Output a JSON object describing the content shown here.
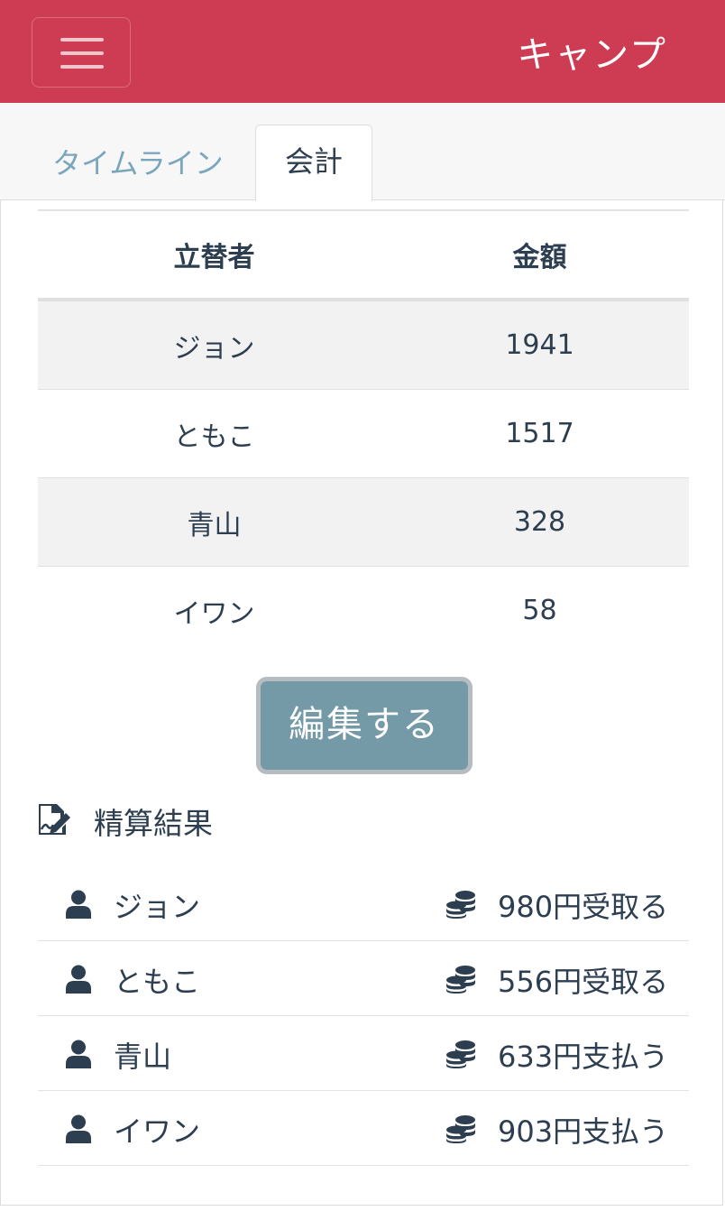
{
  "navbar": {
    "brand": "キャンプ",
    "color": "#cd3c52",
    "menu_icon": "hamburger-menu-icon"
  },
  "tabs": [
    {
      "label": "タイムライン",
      "active": false
    },
    {
      "label": "会計",
      "active": true
    }
  ],
  "table": {
    "headers": [
      "立替者",
      "金額"
    ],
    "rows": [
      {
        "payer": "ジョン",
        "amount": "1941"
      },
      {
        "payer": "ともこ",
        "amount": "1517"
      },
      {
        "payer": "青山",
        "amount": "328"
      },
      {
        "payer": "イワン",
        "amount": "58"
      }
    ]
  },
  "edit_button": {
    "label": "編集する"
  },
  "settlement": {
    "title": "精算結果",
    "icon": "file-signature-icon",
    "items": [
      {
        "name": "ジョン",
        "result": "980円受取る"
      },
      {
        "name": "ともこ",
        "result": "556円受取る"
      },
      {
        "name": "青山",
        "result": "633円支払う"
      },
      {
        "name": "イワン",
        "result": "903円支払う"
      }
    ]
  }
}
